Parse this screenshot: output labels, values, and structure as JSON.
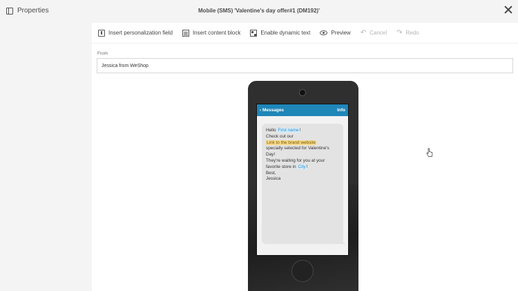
{
  "header": {
    "properties_label": "Properties",
    "title": "Mobile (SMS) 'Valentine's day offer#1 (DM192)'"
  },
  "toolbar": {
    "insert_personalization": "Insert personalization field",
    "insert_content_block": "Insert content block",
    "enable_dynamic_text": "Enable dynamic text",
    "preview": "Preview",
    "cancel": "Cancel",
    "redo": "Redo"
  },
  "from": {
    "label": "From",
    "value": "Jessica from WeShop"
  },
  "phone": {
    "back_label": "‹ Messages",
    "info_label": "Info"
  },
  "message": {
    "hello": "Hello",
    "first_name": "First name",
    "exclaim1": "!",
    "check_out": "Check out our",
    "link": "Link to the brand website",
    "line3": "specially selected for Valentine's Day!",
    "line4": "They're waiting for you at your favorite store in",
    "city": "City",
    "exclaim2": "!",
    "best": "Best,",
    "signature": "Jessica"
  },
  "colors": {
    "accent": "#1f86b8",
    "highlight_field": "#d6ebf7",
    "highlight_link": "#f5d98a"
  }
}
